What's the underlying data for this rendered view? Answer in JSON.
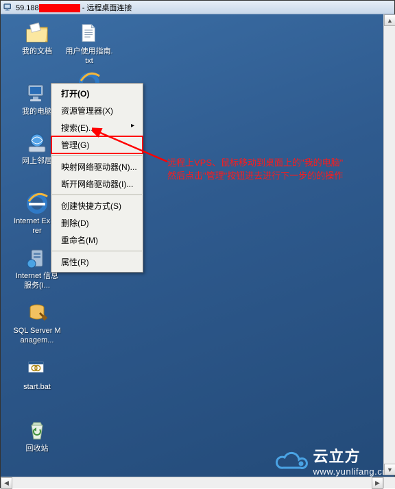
{
  "titlebar": {
    "ip_prefix": "59.188",
    "suffix": " - 远程桌面连接"
  },
  "desktop_icons": {
    "mydocs": "我的文档",
    "guide": "用户使用指南.txt",
    "mycomputer": "我的电脑",
    "network": "网上邻居",
    "ie": "Internet Explorer",
    "iis": "Internet 信息服务(I...",
    "ssms": "SQL Server Managem...",
    "startbat": "start.bat",
    "recycle": "回收站"
  },
  "context_menu": {
    "open": "打开(O)",
    "explorer": "资源管理器(X)",
    "search": "搜索(E)...",
    "manage": "管理(G)",
    "map_drive": "映射网络驱动器(N)...",
    "disconnect_drive": "断开网络驱动器(I)...",
    "create_shortcut": "创建快捷方式(S)",
    "delete": "删除(D)",
    "rename": "重命名(M)",
    "properties": "属性(R)"
  },
  "annotation": {
    "line1": "远程上VPS、鼠标移动到桌面上的\"我的电脑\"",
    "line2": "然后点击\"管理\"按钮进去进行下一步的的操作"
  },
  "watermark": {
    "brand": "云立方",
    "url": "www.yunlifang.cn"
  }
}
